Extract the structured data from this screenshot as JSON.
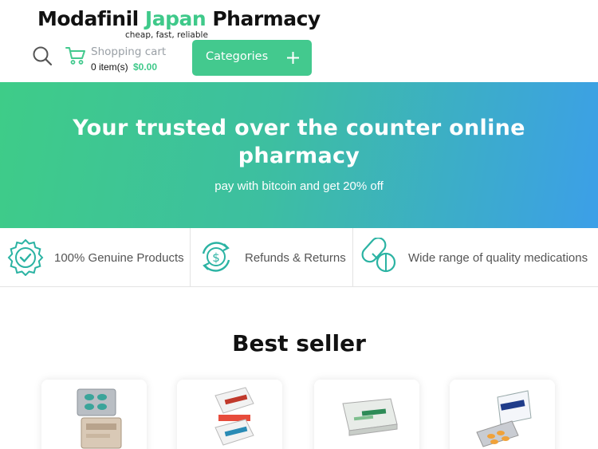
{
  "header": {
    "logo_part1": "Modafinil ",
    "logo_accent": "Japan",
    "logo_part3": " Pharmacy",
    "tagline": "cheap, fast, reliable",
    "search_icon": "search-icon",
    "cart": {
      "icon": "cart-icon",
      "title": "Shopping cart",
      "items": "0 item(s)",
      "total": "$0.00"
    },
    "categories_label": "Categories",
    "categories_icon": "plus-icon"
  },
  "hero": {
    "title": "Your trusted over the counter online pharmacy",
    "subtitle": "pay with bitcoin and get 20% off"
  },
  "features": [
    {
      "icon": "badge-check-icon",
      "label": "100% Genuine Products"
    },
    {
      "icon": "refund-icon",
      "label": "Refunds & Returns"
    },
    {
      "icon": "pills-icon",
      "label": "Wide range of quality medications"
    }
  ],
  "best_seller": {
    "title": "Best seller",
    "products": [
      {
        "image": "blister-pack-image"
      },
      {
        "image": "stacked-boxes-image"
      },
      {
        "image": "green-box-image"
      },
      {
        "image": "blue-box-tablets-image"
      }
    ]
  },
  "colors": {
    "accent": "#43c98e",
    "hero_start": "#3ecc88",
    "hero_end": "#3c9fe8",
    "icon_teal": "#2bb3a3"
  }
}
